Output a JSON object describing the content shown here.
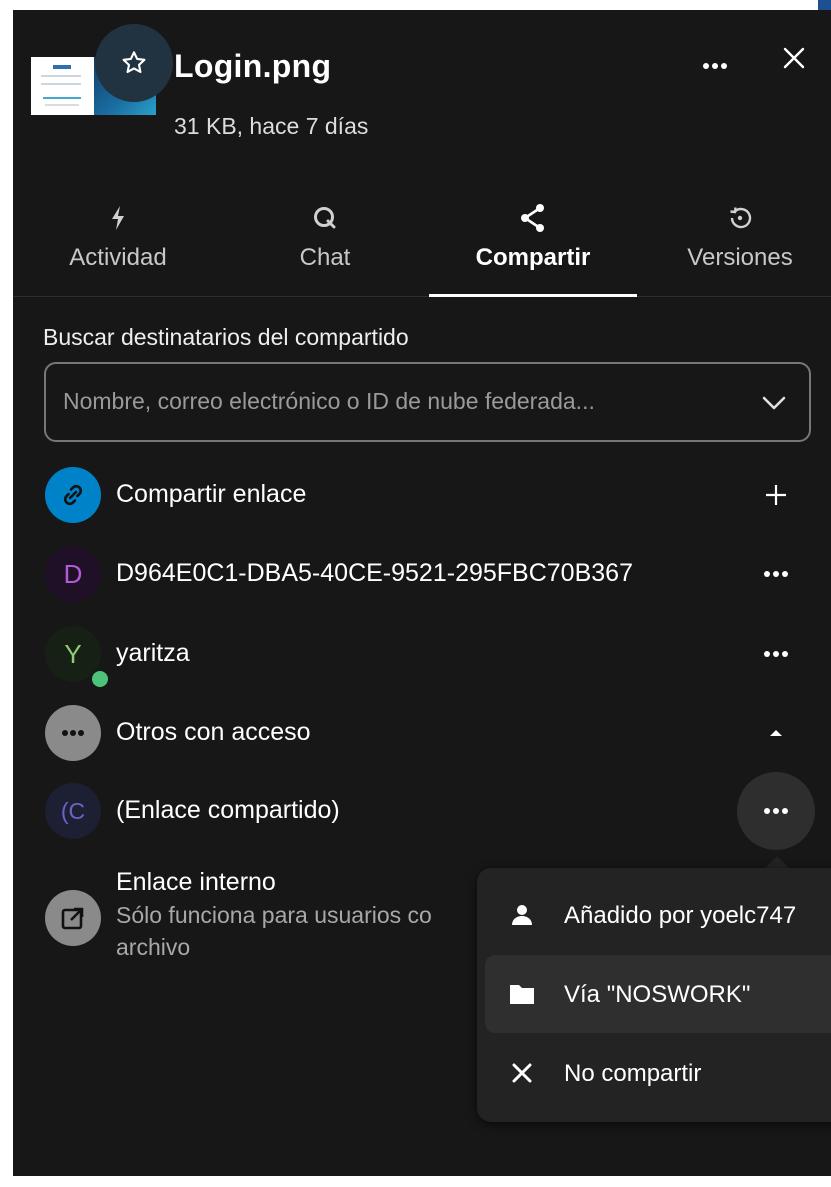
{
  "file": {
    "name": "Login.png",
    "meta": "31 KB, hace 7 días"
  },
  "tabs": [
    {
      "label": "Actividad",
      "icon": "activity-bolt-icon",
      "active": false
    },
    {
      "label": "Chat",
      "icon": "chat-icon",
      "active": false
    },
    {
      "label": "Compartir",
      "icon": "share-icon",
      "active": true
    },
    {
      "label": "Versiones",
      "icon": "history-icon",
      "active": false
    }
  ],
  "search": {
    "label": "Buscar destinatarios del compartido",
    "placeholder": "Nombre, correo electrónico o ID de nube federada..."
  },
  "shares": [
    {
      "label": "Compartir enlace",
      "avatar": "",
      "avatar_color": "#0082c9",
      "action": "plus"
    },
    {
      "label": "D964E0C1-DBA5-40CE-9521-295FBC70B367",
      "avatar": "D",
      "avatar_color": "#1f1027",
      "avatar_text_color": "#b25ad8",
      "action": "more"
    },
    {
      "label": "yaritza",
      "avatar": "Y",
      "avatar_color": "#162015",
      "avatar_text_color": "#8fcc76",
      "status": "online",
      "action": "more"
    },
    {
      "label": "Otros con acceso",
      "avatar": "",
      "avatar_color": "#8a8a8a",
      "action": "collapse"
    },
    {
      "label": "(Enlace compartido)",
      "avatar": "(C",
      "avatar_color": "#1d1f33",
      "avatar_text_color": "#6c62c8",
      "action": "more"
    }
  ],
  "internal_link": {
    "title": "Enlace interno",
    "desc_line1": "Sólo funciona para usuarios co",
    "desc_line2": "archivo"
  },
  "popover": {
    "items": [
      {
        "label": "Añadido por yoelc747",
        "icon": "user-icon"
      },
      {
        "label": "Vía \"NOSWORK\"",
        "icon": "folder-icon",
        "highlighted": true
      },
      {
        "label": "No compartir",
        "icon": "close-icon"
      }
    ]
  }
}
